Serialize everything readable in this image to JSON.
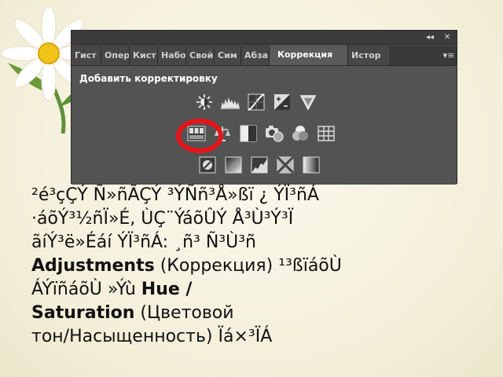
{
  "panel": {
    "topbar": {
      "collapse_glyph": "◂◂",
      "close_glyph": "✕"
    },
    "tabs": [
      {
        "label": "Гист",
        "active": false
      },
      {
        "label": "Опер",
        "active": false
      },
      {
        "label": "Кист",
        "active": false
      },
      {
        "label": "Набо",
        "active": false
      },
      {
        "label": "Свой",
        "active": false
      },
      {
        "label": "Сим",
        "active": false
      },
      {
        "label": "Абза",
        "active": false
      },
      {
        "label": "Коррекция",
        "active": true
      },
      {
        "label": "Истор",
        "active": false
      }
    ],
    "tab_menu_glyph": "▾≡",
    "add_adjustment_title": "Добавить корректировку",
    "icon_rows": [
      [
        "brightness-contrast-icon",
        "levels-icon",
        "curves-icon",
        "exposure-icon",
        "vibrance-icon"
      ],
      [
        "hue-saturation-icon",
        "color-balance-icon",
        "black-white-icon",
        "photo-filter-icon",
        "channel-mixer-icon",
        "color-lookup-icon"
      ],
      [
        "invert-icon",
        "posterize-icon",
        "threshold-icon",
        "selective-color-icon",
        "gradient-map-icon"
      ]
    ],
    "highlighted_icon": "hue-saturation-icon",
    "ring_color": "#e8141b"
  },
  "caption": {
    "line1": "²é³çÇÝ Ñ»ñÃÇÝ ³ÝÑñ³Å»ßï ¿ ÝÏ³ñÁ",
    "line2": "·áõÝ³½ñÏ»É, ÙÇ¨ÝáõÛÝ Å³Ù³Ý³Ï",
    "line3": "ãíÝ³ë»Éáí ÝÏ³ñÁ: ¸ñ³ Ñ³Ù³ñ",
    "bold1": "Adjustments",
    "line4_rest": " (Коррекция) ¹³ßïáõÙ",
    "line5_start": "ÁÝïñáõÙ »Ýù  ",
    "bold2": "Hue /",
    "bold3": "Saturation",
    "line6_rest": " (Цветовой",
    "line7": "тон/Насыщенность) Ïá×³ÏÁ"
  },
  "colors": {
    "panel_bg": "#535353",
    "tab_bar_bg": "#3a3a3a",
    "highlight_ring": "#e8141b",
    "slide_bg": "#f6f3e1"
  }
}
